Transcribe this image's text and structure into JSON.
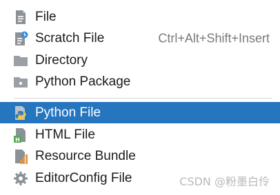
{
  "menu": {
    "items": [
      {
        "label": "File",
        "icon": "file-icon"
      },
      {
        "label": "Scratch File",
        "icon": "scratch-file-icon",
        "shortcut": "Ctrl+Alt+Shift+Insert"
      },
      {
        "label": "Directory",
        "icon": "folder-icon"
      },
      {
        "label": "Python Package",
        "icon": "package-folder-icon"
      },
      {
        "label": "Python File",
        "icon": "python-file-icon",
        "selected": true
      },
      {
        "label": "HTML File",
        "icon": "html-file-icon"
      },
      {
        "label": "Resource Bundle",
        "icon": "resource-bundle-icon"
      },
      {
        "label": "EditorConfig File",
        "icon": "gear-icon"
      }
    ]
  },
  "watermark": "CSDN @粉墨白伶",
  "colors": {
    "selection": "#2675bf",
    "shortcut": "#7a7a7a",
    "icon_gray": "#8c9196"
  }
}
